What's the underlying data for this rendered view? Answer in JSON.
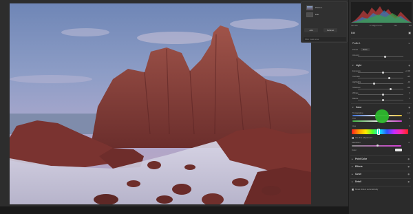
{
  "colors": {
    "accent": "#2db82d",
    "panel_bg": "#2b2b2b",
    "canvas_bg": "#2d2d2d"
  },
  "histogram": {
    "info": [
      "ISO 100",
      "17-40@17.0mm",
      "f/16",
      "30s"
    ]
  },
  "edit": {
    "label": "Edit"
  },
  "layers": {
    "rows": [
      {
        "label": "Photo 1"
      },
      {
        "label": "Edit"
      }
    ],
    "buttons": {
      "add": "Add",
      "subtract": "Subtract"
    },
    "footer": "Filter mask area"
  },
  "profile": {
    "title": "Profile 1",
    "preset_label": "Preset",
    "preset_value": "None",
    "amount_label": "Amount"
  },
  "light": {
    "title": "Light",
    "rows": [
      {
        "label": "Exposure",
        "value": "+0.00"
      },
      {
        "label": "Contrast",
        "value": "+25"
      },
      {
        "label": "Highlights",
        "value": "-40"
      },
      {
        "label": "Shadows",
        "value": "+30"
      },
      {
        "label": "Whites",
        "value": "0"
      },
      {
        "label": "Blacks",
        "value": "0"
      }
    ]
  },
  "color": {
    "title": "Color",
    "temperature_label": "Temperature",
    "temperature_value": "-1.0",
    "tint_label": "Tint",
    "tint_value": "0",
    "hue_label": "Hue",
    "hue_value": "0",
    "use_fine": "Use fine adjustment",
    "saturation_label": "Saturation",
    "saturation_value": "0",
    "color_label": "Color"
  },
  "sections": {
    "point_color": "Point Color",
    "effects": "Effects",
    "curve": "Curve",
    "detail": "Detail"
  },
  "footer": {
    "reset_label": "Reset sliders automatically"
  }
}
